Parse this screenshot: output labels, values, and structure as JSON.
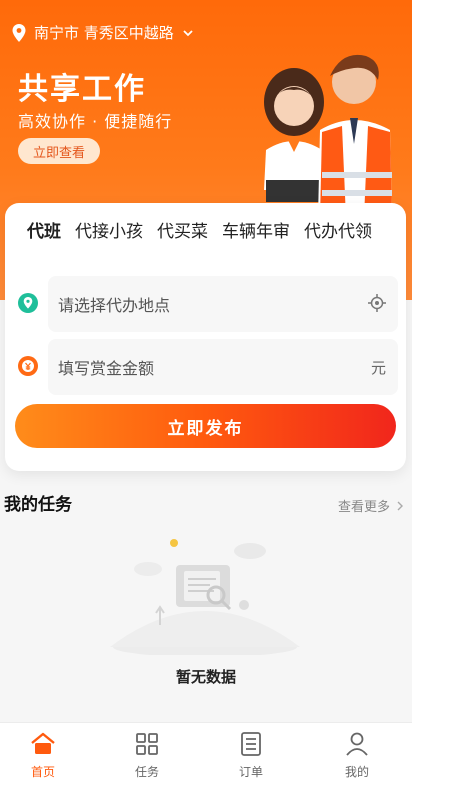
{
  "location": {
    "text": "南宁市 青秀区中越路"
  },
  "hero": {
    "title": "共享工作",
    "subtitle": "高效协作 · 便捷随行",
    "cta": "立即查看"
  },
  "card": {
    "tabs": [
      {
        "label": "代班"
      },
      {
        "label": "代接小孩"
      },
      {
        "label": "代买菜"
      },
      {
        "label": "车辆年审"
      },
      {
        "label": "代办代领"
      }
    ],
    "location_field": {
      "placeholder": "请选择代办地点"
    },
    "amount_field": {
      "placeholder": "填写赏金金额",
      "unit": "元"
    },
    "publish_label": "立即发布"
  },
  "tasks": {
    "title": "我的任务",
    "more": "查看更多",
    "empty": "暂无数据"
  },
  "tabbar": {
    "items": [
      {
        "label": "首页",
        "icon": "home-icon"
      },
      {
        "label": "任务",
        "icon": "grid-icon"
      },
      {
        "label": "订单",
        "icon": "document-icon"
      },
      {
        "label": "我的",
        "icon": "user-icon"
      }
    ]
  },
  "colors": {
    "brand": "#ff5a0e",
    "hero": "#ff6a0a"
  }
}
